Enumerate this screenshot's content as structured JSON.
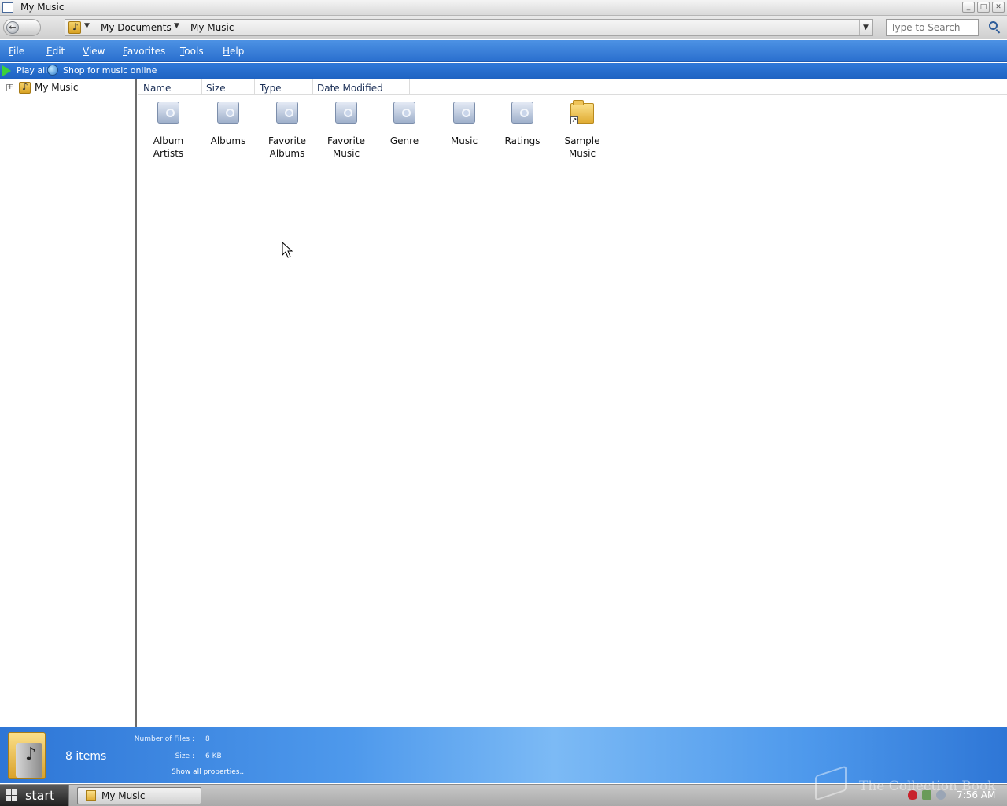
{
  "window": {
    "title": "My Music",
    "caption_buttons": [
      "minimize",
      "maximize",
      "close"
    ]
  },
  "address_bar": {
    "crumbs": [
      "My Documents",
      "My Music"
    ],
    "search_placeholder": "Type to Search"
  },
  "menu": {
    "items": [
      {
        "accel": "F",
        "rest": "ile"
      },
      {
        "accel": "E",
        "rest": "dit"
      },
      {
        "accel": "V",
        "rest": "iew"
      },
      {
        "accel": "F",
        "rest": "avorites"
      },
      {
        "accel": "T",
        "rest": "ools"
      },
      {
        "accel": "H",
        "rest": "elp"
      }
    ]
  },
  "commands": {
    "play_all": "Play all",
    "shop": "Shop for music online"
  },
  "tree": {
    "root_label": "My Music",
    "expander": "+"
  },
  "columns": [
    "Name",
    "Size",
    "Type",
    "Date Modified"
  ],
  "items": [
    {
      "label": "Album Artists",
      "icon": "search-folder-icon"
    },
    {
      "label": "Albums",
      "icon": "search-folder-icon"
    },
    {
      "label": "Favorite Albums",
      "icon": "search-folder-icon"
    },
    {
      "label": "Favorite Music",
      "icon": "search-folder-icon"
    },
    {
      "label": "Genre",
      "icon": "search-folder-icon"
    },
    {
      "label": "Music",
      "icon": "search-folder-icon"
    },
    {
      "label": "Ratings",
      "icon": "search-folder-icon"
    },
    {
      "label": "Sample Music",
      "icon": "folder-shortcut-icon"
    }
  ],
  "details": {
    "items_count": "8 items",
    "number_of_files_label": "Number of Files",
    "number_of_files_value": "8",
    "size_label": "Size",
    "size_value": "6 KB",
    "show_all": "Show all properties..."
  },
  "taskbar": {
    "start_label": "start",
    "task_label": "My Music",
    "clock": "7:56 AM"
  },
  "watermark": {
    "text": "The Collection Book"
  },
  "colors": {
    "menubar": "#2a6fce",
    "details_pane": "#4e99ec",
    "taskbar": "#a9a9a9"
  }
}
